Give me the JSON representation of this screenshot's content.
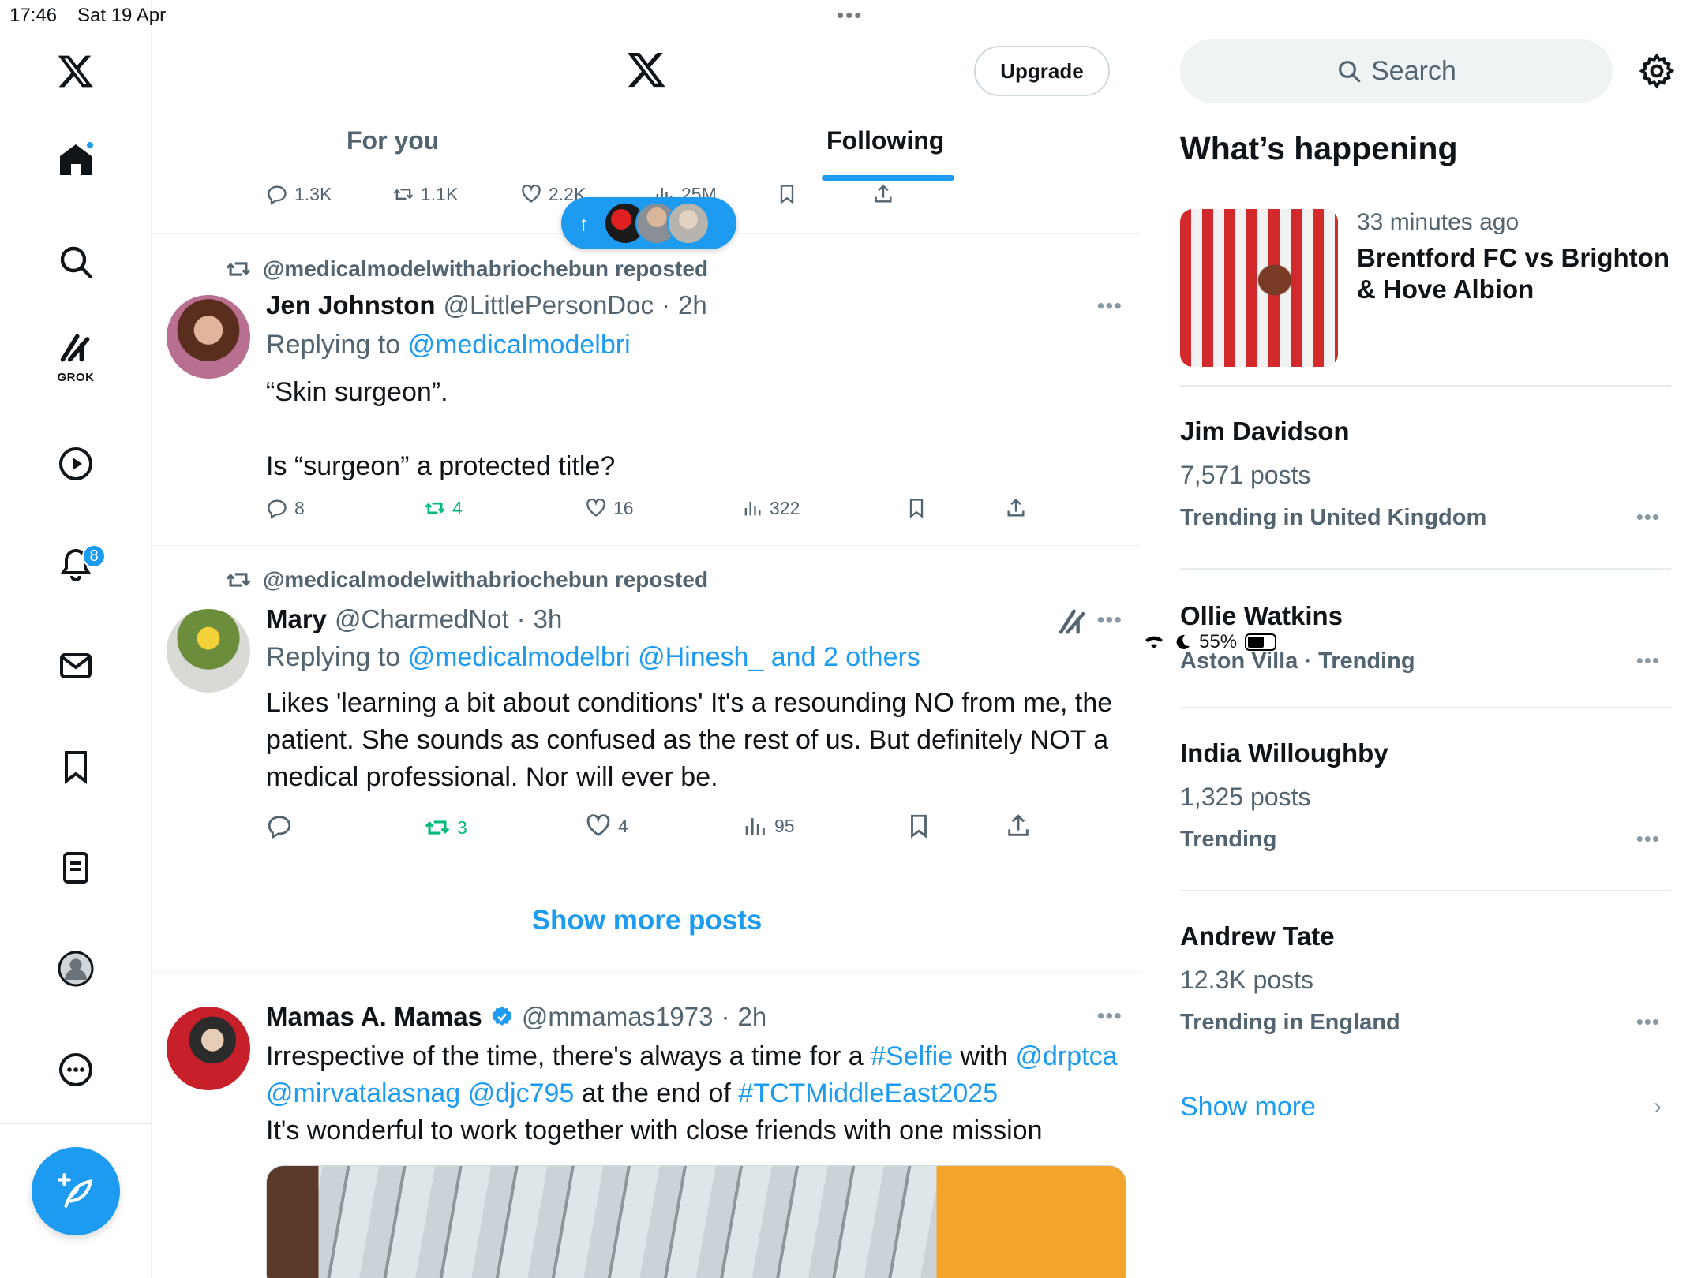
{
  "status_bar": {
    "time": "17:46",
    "date": "Sat 19 Apr",
    "battery": "55%"
  },
  "nav": {
    "notifications_badge": "8",
    "grok_label": "GROK"
  },
  "header": {
    "upgrade_label": "Upgrade",
    "tabs": [
      {
        "label": "For you"
      },
      {
        "label": "Following"
      }
    ]
  },
  "prev_post_actions": {
    "replies": "1.3K",
    "reposts": "1.1K",
    "likes": "2.2K",
    "views": "25M"
  },
  "posts": [
    {
      "reposted_by": "@medicalmodelwithabriochebun reposted",
      "name": "Jen Johnston",
      "handle": "@LittlePersonDoc",
      "time": "2h",
      "replying_prefix": "Replying to",
      "replying_to": "@medicalmodelbri",
      "text_line1": "“Skin surgeon”.",
      "text_line2": "Is “surgeon” a protected title?",
      "replies": "8",
      "reposts": "4",
      "likes": "16",
      "views": "322"
    },
    {
      "reposted_by": "@medicalmodelwithabriochebun reposted",
      "name": "Mary",
      "handle": "@CharmedNot",
      "time": "3h",
      "replying_prefix": "Replying to",
      "replying_to": "@medicalmodelbri @Hinesh_ and 2 others",
      "text": "Likes 'learning a bit about conditions'  It's a resounding NO from me, the patient.  She sounds as confused as the rest of us.  But definitely NOT a medical professional.  Nor will ever be.",
      "replies": "",
      "reposts": "3",
      "likes": "4",
      "views": "95"
    },
    {
      "name": "Mamas A. Mamas",
      "handle": "@mmamas1973",
      "time": "2h",
      "text_part1": "Irrespective of the time, there's always a time for a ",
      "hashtag1": "#Selfie",
      "text_part2": " with ",
      "mention1": "@drptca",
      "mention2": "@mirvatalasnag",
      "mention3": "@djc795",
      "text_part3": "  at the end of ",
      "hashtag2": "#TCTMiddleEast2025",
      "text_line3": "It's wonderful to work together with close friends with one mission"
    }
  ],
  "show_more_posts": "Show more posts",
  "sidebar": {
    "search_placeholder": "Search",
    "heading": "What’s happening",
    "event": {
      "meta": "33 minutes ago",
      "title": "Brentford FC vs Brighton & Hove Albion"
    },
    "trends": [
      {
        "name": "Jim Davidson",
        "count": "7,571 posts",
        "context": "Trending in United Kingdom"
      },
      {
        "name": "Ollie Watkins",
        "count": "",
        "context": "Aston Villa · Trending"
      },
      {
        "name": "India Willoughby",
        "count": "1,325 posts",
        "context": "Trending"
      },
      {
        "name": "Andrew Tate",
        "count": "12.3K posts",
        "context": "Trending in England"
      }
    ],
    "show_more": "Show more"
  },
  "colors": {
    "accent": "#1d9bf0",
    "repost_green": "#00ba7c",
    "muted": "#536471"
  }
}
